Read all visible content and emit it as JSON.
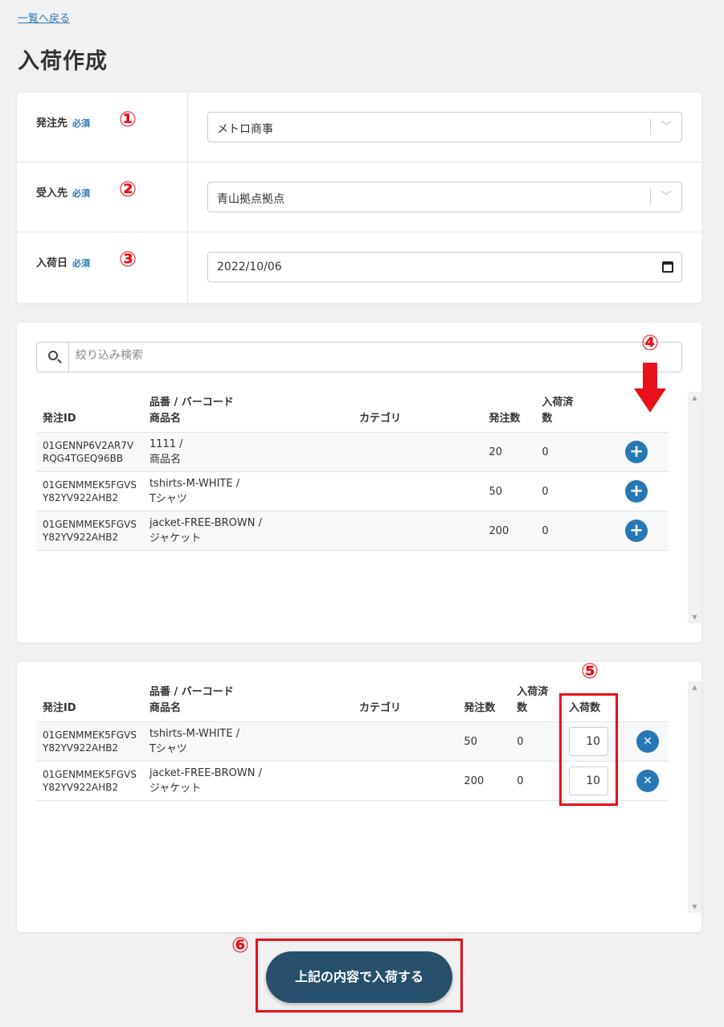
{
  "nav": {
    "back_label": "一覧へ戻る"
  },
  "page": {
    "title": "入荷作成"
  },
  "form": {
    "required_label": "必須",
    "supplier": {
      "label": "発注先",
      "value": "メトロ商事",
      "marker": "①"
    },
    "receiver": {
      "label": "受入先",
      "value": "青山拠点拠点",
      "marker": "②"
    },
    "arrival_date": {
      "label": "入荷日",
      "value": "2022/10/06",
      "marker": "③"
    }
  },
  "product_list": {
    "search_placeholder": "絞り込み検索",
    "marker": "④",
    "columns": {
      "order_id": "発注ID",
      "sku_line1": "品番 / バーコード",
      "sku_line2": "商品名",
      "category": "カテゴリ",
      "ordered": "発注数",
      "received_line1": "入荷済",
      "received_line2": "数"
    },
    "rows": [
      {
        "order_id_1": "01GENNP6V2AR7V",
        "order_id_2": "RQG4TGEQ96BB",
        "sku": "1111 /",
        "name": "商品名",
        "category": "",
        "ordered": "20",
        "received": "0"
      },
      {
        "order_id_1": "01GENMMEK5FGVS",
        "order_id_2": "Y82YV922AHB2",
        "sku": "tshirts-M-WHITE /",
        "name": "Tシャツ",
        "category": "",
        "ordered": "50",
        "received": "0"
      },
      {
        "order_id_1": "01GENMMEK5FGVS",
        "order_id_2": "Y82YV922AHB2",
        "sku": "jacket-FREE-BROWN /",
        "name": "ジャケット",
        "category": "",
        "ordered": "200",
        "received": "0"
      }
    ],
    "add_icon": "plus-icon"
  },
  "selected_list": {
    "marker": "⑤",
    "columns": {
      "order_id": "発注ID",
      "sku_line1": "品番 / バーコード",
      "sku_line2": "商品名",
      "category": "カテゴリ",
      "ordered": "発注数",
      "received_line1": "入荷済",
      "received_line2": "数",
      "qty": "入荷数"
    },
    "rows": [
      {
        "order_id_1": "01GENMMEK5FGVS",
        "order_id_2": "Y82YV922AHB2",
        "sku": "tshirts-M-WHITE /",
        "name": "Tシャツ",
        "category": "",
        "ordered": "50",
        "received": "0",
        "qty": "10"
      },
      {
        "order_id_1": "01GENMMEK5FGVS",
        "order_id_2": "Y82YV922AHB2",
        "sku": "jacket-FREE-BROWN /",
        "name": "ジャケット",
        "category": "",
        "ordered": "200",
        "received": "0",
        "qty": "10"
      }
    ],
    "remove_icon": "close-icon"
  },
  "submit": {
    "label": "上記の内容で入荷する",
    "marker": "⑥"
  },
  "colors": {
    "accent": "#2678b5",
    "annotation": "#e8101a",
    "submit_bg": "#27506a"
  }
}
